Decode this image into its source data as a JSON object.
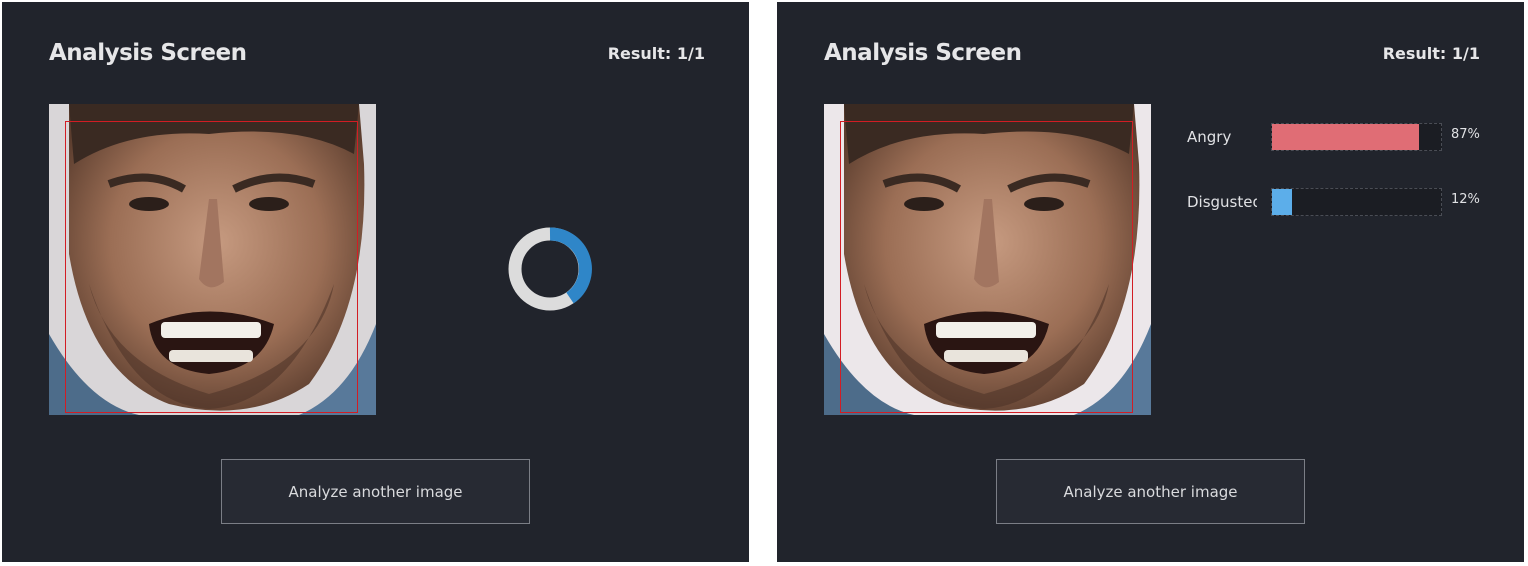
{
  "left": {
    "title": "Analysis Screen",
    "result": "Result: 1/1",
    "button_label": "Analyze another image"
  },
  "right": {
    "title": "Analysis Screen",
    "result": "Result: 1/1",
    "button_label": "Analyze another image",
    "emotions": [
      {
        "label": "Angry",
        "value_text": "87%",
        "value": 0.87,
        "color": "#e06d75"
      },
      {
        "label": "Disgusted",
        "value_text": "12%",
        "value": 0.12,
        "color": "#5caeea"
      }
    ]
  },
  "colors": {
    "panel_bg": "#21242c",
    "face_box": "#d21d24",
    "spinner_track": "#dcdcdc",
    "spinner_accent": "#2f86c8"
  }
}
